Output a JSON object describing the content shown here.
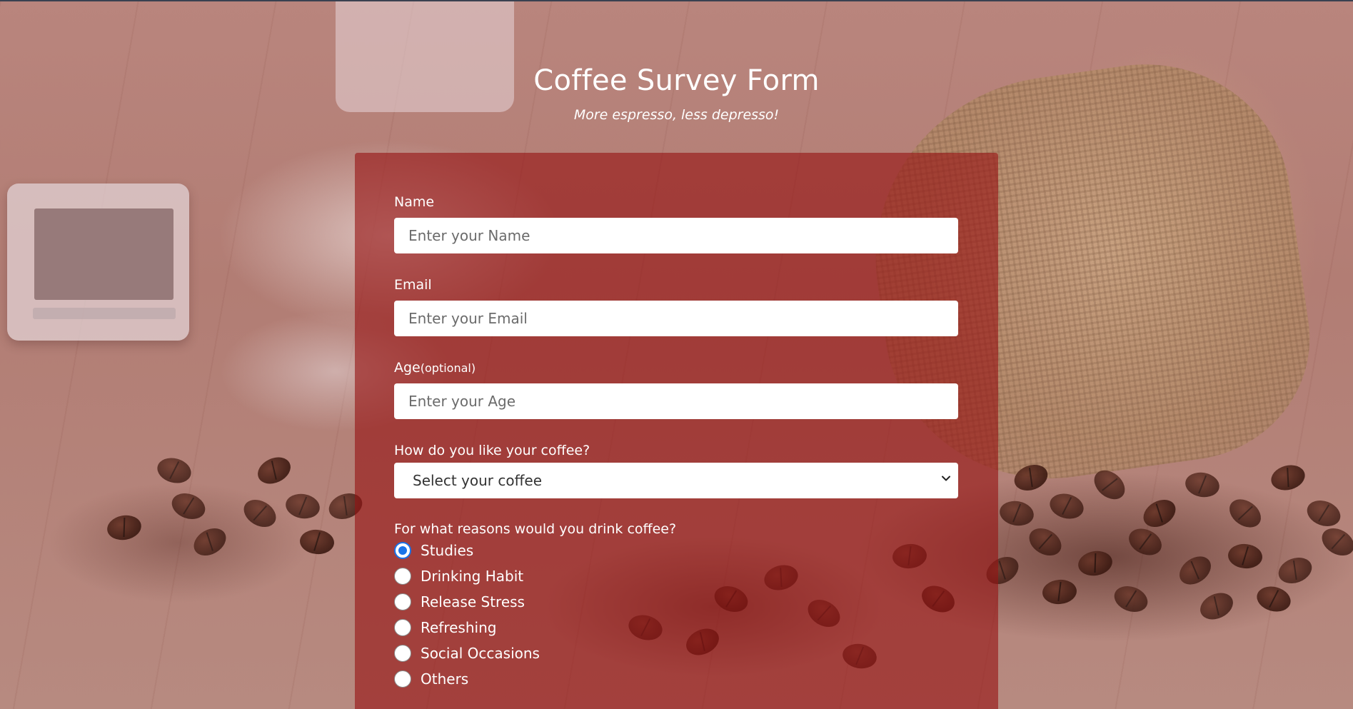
{
  "header": {
    "title": "Coffee Survey Form",
    "subtitle": "More espresso, less depresso!"
  },
  "form": {
    "name": {
      "label": "Name",
      "placeholder": "Enter your Name"
    },
    "email": {
      "label": "Email",
      "placeholder": "Enter your Email"
    },
    "age": {
      "label": "Age",
      "optional": "(optional)",
      "placeholder": "Enter your Age"
    },
    "coffee": {
      "label": "How do you like your coffee?",
      "selected": "Select your coffee"
    },
    "reasons": {
      "label": "For what reasons would you drink coffee?",
      "options": [
        "Studies",
        "Drinking Habit",
        "Release Stress",
        "Refreshing",
        "Social Occasions",
        "Others"
      ],
      "selected": "Studies"
    }
  },
  "colors": {
    "panel": "#961414",
    "radio_accent": "#1a73e8"
  }
}
